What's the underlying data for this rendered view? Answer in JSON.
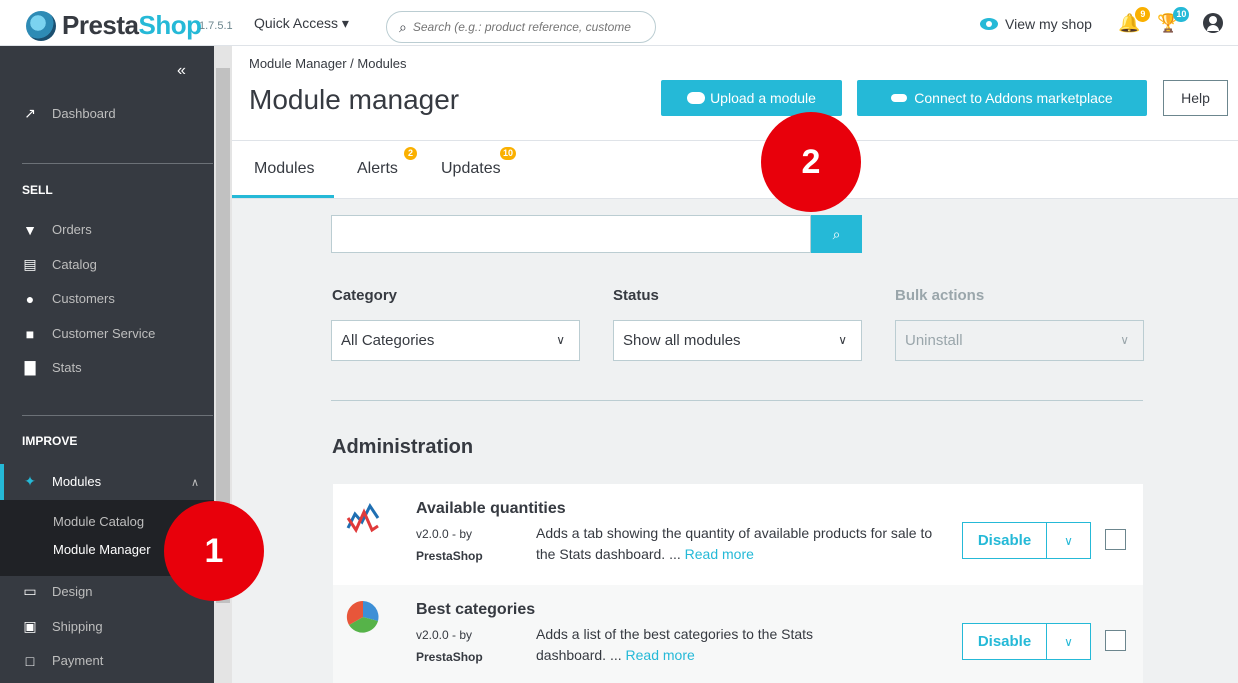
{
  "header": {
    "brand_part1": "Presta",
    "brand_part2": "Shop",
    "version": "1.7.5.1",
    "quick_access": "Quick Access ▾",
    "search_placeholder": "Search (e.g.: product reference, custome",
    "view_shop": "View my shop",
    "notif_orders_count": "9",
    "notif_customers_count": "10"
  },
  "sidebar": {
    "collapse": "«",
    "dashboard": "Dashboard",
    "sections": [
      {
        "title": "SELL",
        "items": [
          "Orders",
          "Catalog",
          "Customers",
          "Customer Service",
          "Stats"
        ]
      },
      {
        "title": "IMPROVE",
        "items": [
          "Modules",
          "Design",
          "Shipping",
          "Payment"
        ]
      }
    ],
    "modules_submenu": [
      "Module Catalog",
      "Module Manager"
    ]
  },
  "page": {
    "breadcrumb": "Module Manager  /  Modules",
    "title": "Module manager",
    "upload_button": "Upload a module",
    "connect_button": "Connect to Addons marketplace",
    "help_button": "Help"
  },
  "tabs": [
    {
      "label": "Modules",
      "badge": ""
    },
    {
      "label": "Alerts",
      "badge": "2"
    },
    {
      "label": "Updates",
      "badge": "10"
    }
  ],
  "filters": {
    "category_label": "Category",
    "category_value": "All Categories",
    "status_label": "Status",
    "status_value": "Show all modules",
    "bulk_label": "Bulk actions",
    "bulk_value": "Uninstall"
  },
  "section_title": "Administration",
  "modules": [
    {
      "name": "Available quantities",
      "version": "v2.0.0 - by",
      "author": "PrestaShop",
      "description": "Adds a tab showing the quantity of available products for sale to the Stats dashboard. ...",
      "read_more": "Read more",
      "action": "Disable"
    },
    {
      "name": "Best categories",
      "version": "v2.0.0 - by",
      "author": "PrestaShop",
      "description": "Adds a list of the best categories to the Stats dashboard. ...",
      "read_more": "Read more",
      "action": "Disable"
    }
  ],
  "markers": [
    "1",
    "2"
  ],
  "colors": {
    "accent": "#25b9d7",
    "sidebar": "#363a41",
    "marker": "#e8000b",
    "badge": "#fab000"
  }
}
